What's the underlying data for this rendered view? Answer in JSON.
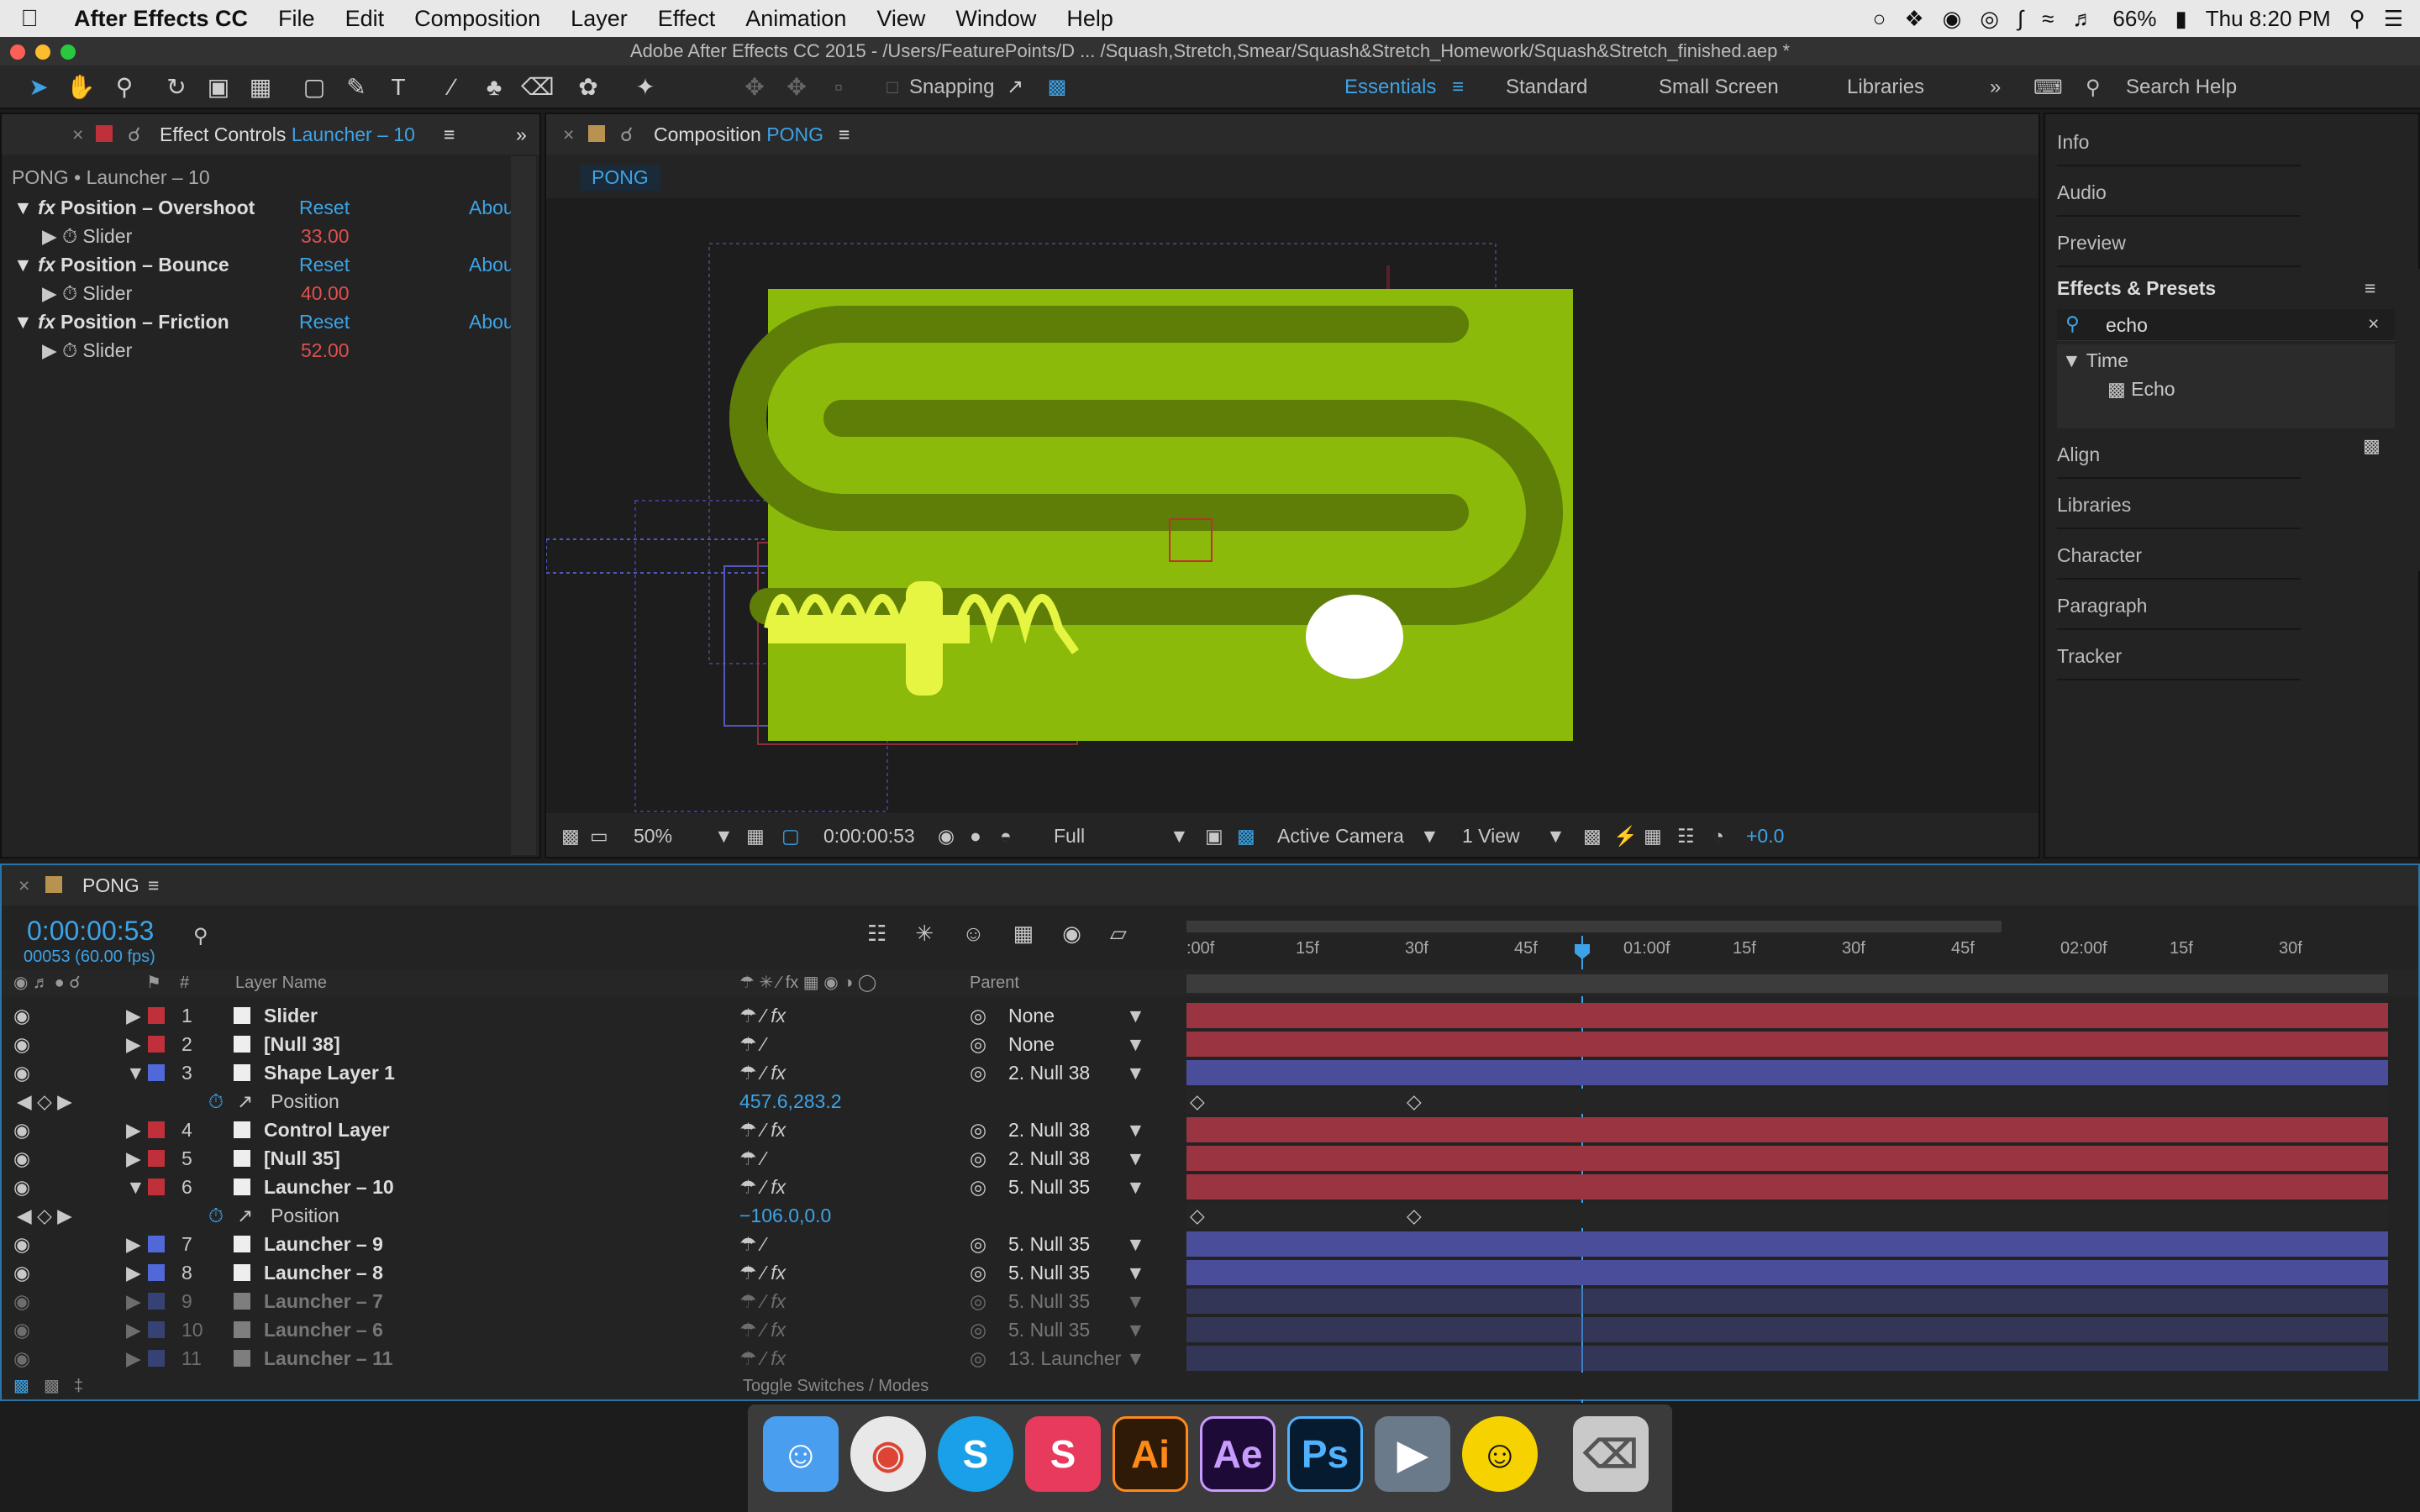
{
  "menubar": {
    "app": "After Effects CC",
    "items": [
      "File",
      "Edit",
      "Composition",
      "Layer",
      "Effect",
      "Animation",
      "View",
      "Window",
      "Help"
    ],
    "battery": "66%",
    "clock": "Thu 8:20 PM"
  },
  "window_title": "Adobe After Effects CC 2015 - /Users/FeaturePoints/D ... /Squash,Stretch,Smear/Squash&Stretch_Homework/Squash&Stretch_finished.aep *",
  "toolbar": {
    "snapping_label": "Snapping",
    "workspaces": [
      "Essentials",
      "Standard",
      "Small Screen",
      "Libraries"
    ],
    "active_workspace": "Essentials",
    "search_help": "Search Help"
  },
  "effect_controls": {
    "tab_prefix": "Effect Controls",
    "tab_layer": "Launcher – 10",
    "subheader": "PONG • Launcher – 10",
    "effects": [
      {
        "name": "Position – Overshoot",
        "reset": "Reset",
        "about": "Abou",
        "param": "Slider",
        "value": "33.00"
      },
      {
        "name": "Position – Bounce",
        "reset": "Reset",
        "about": "Abou",
        "param": "Slider",
        "value": "40.00"
      },
      {
        "name": "Position – Friction",
        "reset": "Reset",
        "about": "Abou",
        "param": "Slider",
        "value": "52.00"
      }
    ]
  },
  "composition": {
    "tab_prefix": "Composition",
    "tab_name": "PONG",
    "comp_button": "PONG",
    "zoom": "50%",
    "timecode": "0:00:00:53",
    "resolution": "Full",
    "camera": "Active Camera",
    "view": "1 View",
    "exposure": "+0.0",
    "colors": {
      "bg": "#8cba0a",
      "track": "#5e7e08",
      "ball": "#ffffff",
      "spring": "#e6f542"
    }
  },
  "right_panel": {
    "items_top": [
      "Info",
      "Audio",
      "Preview"
    ],
    "effects_presets_title": "Effects & Presets",
    "search_value": "echo",
    "tree_category": "Time",
    "tree_item": "Echo",
    "items_bottom": [
      "Align",
      "Libraries",
      "Character",
      "Paragraph",
      "Tracker"
    ]
  },
  "timeline": {
    "tab": "PONG",
    "timecode": "0:00:00:53",
    "frame_info": "00053 (60.00 fps)",
    "col_layer_name": "Layer Name",
    "col_num": "#",
    "col_parent": "Parent",
    "ruler": [
      ":00f",
      "15f",
      "30f",
      "45f",
      "01:00f",
      "15f",
      "30f",
      "45f",
      "02:00f",
      "15f",
      "30f"
    ],
    "toggle_label": "Toggle Switches / Modes",
    "layers": [
      {
        "num": "1",
        "name": "Slider",
        "color": "#c0303a",
        "parent": "None",
        "fx": true
      },
      {
        "num": "2",
        "name": "[Null 38]",
        "color": "#c0303a",
        "parent": "None",
        "fx": false
      },
      {
        "num": "3",
        "name": "Shape Layer 1",
        "color": "#5068d8",
        "parent": "2. Null 38",
        "fx": true,
        "expanded": true,
        "prop": "Position",
        "prop_value": "457.6,283.2"
      },
      {
        "num": "4",
        "name": "Control Layer",
        "color": "#c0303a",
        "parent": "2. Null 38",
        "fx": true
      },
      {
        "num": "5",
        "name": "[Null 35]",
        "color": "#c0303a",
        "parent": "2. Null 38",
        "fx": false
      },
      {
        "num": "6",
        "name": "Launcher – 10",
        "color": "#c0303a",
        "parent": "5. Null 35",
        "fx": true,
        "expanded": true,
        "prop": "Position",
        "prop_value": "−106.0,0.0"
      },
      {
        "num": "7",
        "name": "Launcher – 9",
        "color": "#5068d8",
        "parent": "5. Null 35",
        "fx": false
      },
      {
        "num": "8",
        "name": "Launcher – 8",
        "color": "#5068d8",
        "parent": "5. Null 35",
        "fx": true
      },
      {
        "num": "9",
        "name": "Launcher – 7",
        "color": "#5068d8",
        "parent": "5. Null 35",
        "fx": true
      },
      {
        "num": "10",
        "name": "Launcher – 6",
        "color": "#5068d8",
        "parent": "5. Null 35",
        "fx": true
      },
      {
        "num": "11",
        "name": "Launcher – 11",
        "color": "#5068d8",
        "parent": "13. Launcher",
        "fx": true
      }
    ]
  },
  "dock": {
    "apps": [
      "Finder",
      "Chrome",
      "Skype",
      "Slides",
      "Ai",
      "Ae",
      "Ps",
      "Video",
      "Ghost",
      "Trash"
    ]
  }
}
